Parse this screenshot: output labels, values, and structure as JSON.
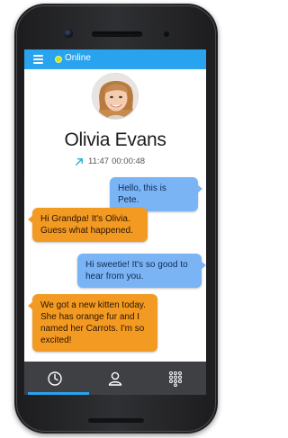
{
  "status_bar": {
    "status_label": "Online",
    "accent_color": "#2aa3ee",
    "status_color": "#c6e51a"
  },
  "contact": {
    "name": "Olivia Evans",
    "call_time": "11:47",
    "call_duration": "00:00:48",
    "call_direction_icon": "outgoing-call-arrow-icon"
  },
  "messages": [
    {
      "direction": "outgoing",
      "text": "Hello, this is Pete."
    },
    {
      "direction": "incoming",
      "text": "Hi Grandpa!  It's Olivia.  Guess what happened."
    },
    {
      "direction": "outgoing",
      "text": "Hi sweetie!  It's so good to hear from you."
    },
    {
      "direction": "incoming",
      "text": "We got a new kitten today.  She has orange fur and I named her Carrots.  I'm so excited!"
    }
  ],
  "bottom_nav": {
    "tabs": [
      {
        "icon": "clock-icon",
        "selected": true
      },
      {
        "icon": "person-icon",
        "selected": false
      },
      {
        "icon": "dialpad-icon",
        "selected": false
      }
    ]
  }
}
